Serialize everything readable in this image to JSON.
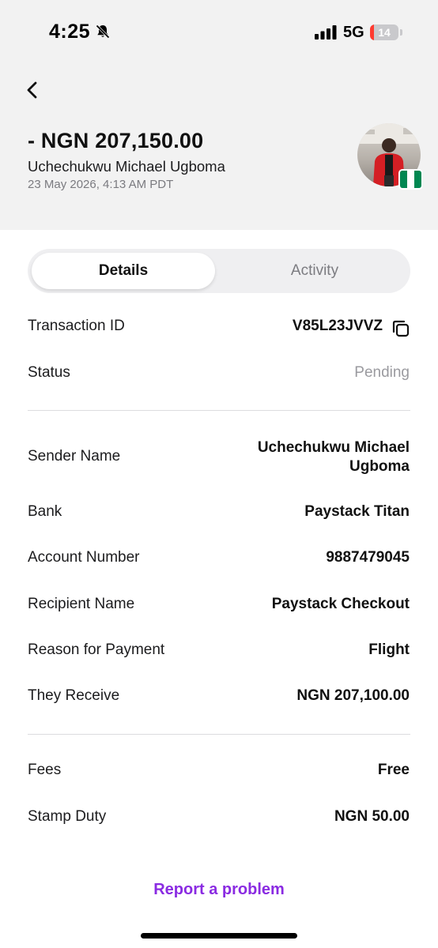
{
  "status_bar": {
    "time": "4:25",
    "network": "5G",
    "battery_level": "14",
    "battery_fraction": 0.14
  },
  "header": {
    "amount": "- NGN 207,150.00",
    "name": "Uchechukwu Michael Ugboma",
    "datetime": "23 May 2026, 4:13 AM PDT",
    "flag_colors": [
      "#008751",
      "#ffffff",
      "#008751"
    ]
  },
  "tabs": [
    {
      "label": "Details",
      "active": true
    },
    {
      "label": "Activity",
      "active": false
    }
  ],
  "details": {
    "transaction_id": {
      "label": "Transaction ID",
      "value": "V85L23JVVZ"
    },
    "status": {
      "label": "Status",
      "value": "Pending"
    },
    "sender_name": {
      "label": "Sender Name",
      "value": "Uchechukwu Michael Ugboma"
    },
    "bank": {
      "label": "Bank",
      "value": "Paystack Titan"
    },
    "account_number": {
      "label": "Account Number",
      "value": "9887479045"
    },
    "recipient_name": {
      "label": "Recipient Name",
      "value": "Paystack Checkout"
    },
    "reason": {
      "label": "Reason for Payment",
      "value": "Flight"
    },
    "they_receive": {
      "label": "They Receive",
      "value": "NGN 207,100.00"
    },
    "fees": {
      "label": "Fees",
      "value": "Free"
    },
    "stamp_duty": {
      "label": "Stamp Duty",
      "value": "NGN 50.00"
    }
  },
  "report_link": "Report a problem",
  "colors": {
    "accent": "#8a2be2",
    "header_bg": "#f2f2f2",
    "pending": "#9a9a9f"
  },
  "icons": [
    "back-chevron-icon",
    "bell-slash-icon",
    "signal-icon",
    "battery-icon",
    "copy-icon",
    "nigeria-flag-icon"
  ]
}
